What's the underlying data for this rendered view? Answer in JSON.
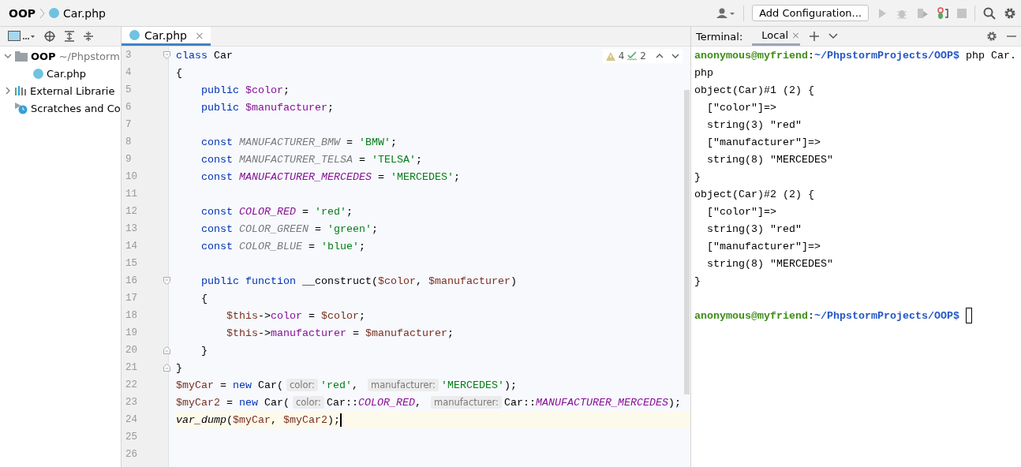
{
  "breadcrumbs": [
    "OOP",
    "Car.php"
  ],
  "run_toolbar": {
    "config_button": "Add Configuration..."
  },
  "project_tree": [
    {
      "name": "OOP",
      "path": "~/Phpstorm",
      "kind": "folder",
      "expanded": true,
      "children": [
        {
          "name": "Car.php",
          "kind": "php"
        }
      ]
    },
    {
      "name": "External Librarie",
      "kind": "library",
      "expanded": false
    },
    {
      "name": "Scratches and Co",
      "kind": "scratch"
    }
  ],
  "editor": {
    "tabs": [
      {
        "label": "Car.php",
        "close": "×",
        "selected": true
      }
    ],
    "inspections": {
      "warnings": "4",
      "typos": "2"
    },
    "lines": [
      {
        "no": "3",
        "kind": "fold_start",
        "current": false,
        "tokens": [
          {
            "kind": "kw",
            "text": "class"
          },
          {
            "kind": "plain",
            "text": " Car"
          }
        ]
      },
      {
        "no": "4",
        "kind": "code",
        "current": false,
        "tokens": [
          {
            "kind": "plain",
            "text": "{"
          }
        ]
      },
      {
        "no": "5",
        "kind": "code",
        "current": false,
        "tokens": [
          {
            "kind": "kw",
            "text": "    public "
          },
          {
            "kind": "prop",
            "text": "$color"
          },
          {
            "kind": "plain",
            "text": ";"
          }
        ]
      },
      {
        "no": "6",
        "kind": "code",
        "current": false,
        "tokens": [
          {
            "kind": "kw",
            "text": "    public "
          },
          {
            "kind": "prop",
            "text": "$manufacturer"
          },
          {
            "kind": "plain",
            "text": ";"
          }
        ]
      },
      {
        "no": "7",
        "kind": "code",
        "current": false
      },
      {
        "no": "8",
        "kind": "code",
        "current": false,
        "tokens": [
          {
            "kind": "kw",
            "text": "    const "
          },
          {
            "kind": "const",
            "text": "MANUFACTURER_BMW"
          },
          {
            "kind": "plain",
            "text": " = "
          },
          {
            "kind": "str",
            "text": "'BMW'"
          },
          {
            "kind": "plain",
            "text": ";"
          }
        ]
      },
      {
        "no": "9",
        "kind": "code",
        "current": false,
        "tokens": [
          {
            "kind": "kw",
            "text": "    const "
          },
          {
            "kind": "const",
            "text": "MANUFACTURER_TELSA"
          },
          {
            "kind": "plain",
            "text": " = "
          },
          {
            "kind": "str",
            "text": "'TELSA'"
          },
          {
            "kind": "plain",
            "text": ";"
          }
        ]
      },
      {
        "no": "10",
        "kind": "code",
        "current": false,
        "tokens": [
          {
            "kind": "kw",
            "text": "    const "
          },
          {
            "kind": "constused",
            "text": "MANUFACTURER_MERCEDES"
          },
          {
            "kind": "plain",
            "text": " = "
          },
          {
            "kind": "str",
            "text": "'MERCEDES'"
          },
          {
            "kind": "plain",
            "text": ";"
          }
        ]
      },
      {
        "no": "11",
        "kind": "code",
        "current": false
      },
      {
        "no": "12",
        "kind": "code",
        "current": false,
        "tokens": [
          {
            "kind": "kw",
            "text": "    const "
          },
          {
            "kind": "constused",
            "text": "COLOR_RED"
          },
          {
            "kind": "plain",
            "text": " = "
          },
          {
            "kind": "str",
            "text": "'red'"
          },
          {
            "kind": "plain",
            "text": ";"
          }
        ]
      },
      {
        "no": "13",
        "kind": "code",
        "current": false,
        "tokens": [
          {
            "kind": "kw",
            "text": "    const "
          },
          {
            "kind": "const",
            "text": "COLOR_GREEN"
          },
          {
            "kind": "plain",
            "text": " = "
          },
          {
            "kind": "str",
            "text": "'green'"
          },
          {
            "kind": "plain",
            "text": ";"
          }
        ]
      },
      {
        "no": "14",
        "kind": "code",
        "current": false,
        "tokens": [
          {
            "kind": "kw",
            "text": "    const "
          },
          {
            "kind": "const",
            "text": "COLOR_BLUE"
          },
          {
            "kind": "plain",
            "text": " = "
          },
          {
            "kind": "str",
            "text": "'blue'"
          },
          {
            "kind": "plain",
            "text": ";"
          }
        ]
      },
      {
        "no": "15",
        "kind": "code",
        "current": false
      },
      {
        "no": "16",
        "kind": "fold_start",
        "current": false,
        "tokens": [
          {
            "kind": "kw",
            "text": "    public function"
          },
          {
            "kind": "plain",
            "text": " __construct("
          },
          {
            "kind": "local",
            "text": "$color"
          },
          {
            "kind": "plain",
            "text": ", "
          },
          {
            "kind": "local",
            "text": "$manufacturer"
          },
          {
            "kind": "plain",
            "text": ")"
          }
        ]
      },
      {
        "no": "17",
        "kind": "code",
        "current": false,
        "tokens": [
          {
            "kind": "plain",
            "text": "    {"
          }
        ]
      },
      {
        "no": "18",
        "kind": "code",
        "current": false,
        "tokens": [
          {
            "kind": "local",
            "text": "        $this"
          },
          {
            "kind": "plain",
            "text": "->"
          },
          {
            "kind": "prop",
            "text": "color"
          },
          {
            "kind": "plain",
            "text": " = "
          },
          {
            "kind": "local",
            "text": "$color"
          },
          {
            "kind": "plain",
            "text": ";"
          }
        ]
      },
      {
        "no": "19",
        "kind": "code",
        "current": false,
        "tokens": [
          {
            "kind": "local",
            "text": "        $this"
          },
          {
            "kind": "plain",
            "text": "->"
          },
          {
            "kind": "prop",
            "text": "manufacturer"
          },
          {
            "kind": "plain",
            "text": " = "
          },
          {
            "kind": "local",
            "text": "$manufacturer"
          },
          {
            "kind": "plain",
            "text": ";"
          }
        ]
      },
      {
        "no": "20",
        "kind": "fold_end",
        "current": false,
        "tokens": [
          {
            "kind": "plain",
            "text": "    }"
          }
        ]
      },
      {
        "no": "21",
        "kind": "fold_end",
        "current": false,
        "tokens": [
          {
            "kind": "plain",
            "text": "}"
          }
        ]
      },
      {
        "no": "22",
        "kind": "code",
        "current": false,
        "tokens": [
          {
            "kind": "local",
            "text": "$myCar"
          },
          {
            "kind": "plain",
            "text": " = "
          },
          {
            "kind": "kw",
            "text": "new"
          },
          {
            "kind": "plain",
            "text": " Car("
          },
          {
            "kind": "hint",
            "text": "color:"
          },
          {
            "kind": "str",
            "text": "'red'"
          },
          {
            "kind": "plain",
            "text": ", "
          },
          {
            "kind": "hint",
            "text": "manufacturer:"
          },
          {
            "kind": "str",
            "text": "'MERCEDES'"
          },
          {
            "kind": "plain",
            "text": ");"
          }
        ]
      },
      {
        "no": "23",
        "kind": "code",
        "current": false,
        "tokens": [
          {
            "kind": "local",
            "text": "$myCar2"
          },
          {
            "kind": "plain",
            "text": " = "
          },
          {
            "kind": "kw",
            "text": "new"
          },
          {
            "kind": "plain",
            "text": " Car("
          },
          {
            "kind": "hint",
            "text": "color:"
          },
          {
            "kind": "plain",
            "text": "Car::"
          },
          {
            "kind": "constused",
            "text": "COLOR_RED"
          },
          {
            "kind": "plain",
            "text": ", "
          },
          {
            "kind": "hint",
            "text": "manufacturer:"
          },
          {
            "kind": "plain",
            "text": "Car::"
          },
          {
            "kind": "constused",
            "text": "MANUFACTURER_MERCEDES"
          },
          {
            "kind": "plain",
            "text": ");"
          }
        ]
      },
      {
        "no": "24",
        "kind": "code",
        "current": true,
        "tokens": [
          {
            "kind": "fn",
            "text": "var_dump"
          },
          {
            "kind": "plain",
            "text": "("
          },
          {
            "kind": "local",
            "text": "$myCar"
          },
          {
            "kind": "plain",
            "text": ", "
          },
          {
            "kind": "local",
            "text": "$myCar2"
          },
          {
            "kind": "plain",
            "text": ");"
          }
        ]
      },
      {
        "no": "25",
        "kind": "code",
        "current": false
      },
      {
        "no": "26",
        "kind": "code",
        "current": false
      }
    ]
  },
  "terminal": {
    "title": "Terminal:",
    "tabs": [
      {
        "label": "Local",
        "close": "×",
        "selected": true
      }
    ],
    "lines": [
      {
        "segments": [
          {
            "kind": "user",
            "text": "anonymous@myfriend"
          },
          {
            "kind": "plain",
            "text": ":"
          },
          {
            "kind": "path",
            "text": "~/PhpstormProjects/OOP$"
          },
          {
            "kind": "plain",
            "text": " php Car."
          }
        ]
      },
      {
        "segments": [
          {
            "kind": "plain",
            "text": "php"
          }
        ]
      },
      {
        "segments": [
          {
            "kind": "plain",
            "text": "object(Car)#1 (2) {"
          }
        ]
      },
      {
        "segments": [
          {
            "kind": "plain",
            "text": "  [\"color\"]=>"
          }
        ]
      },
      {
        "segments": [
          {
            "kind": "plain",
            "text": "  string(3) \"red\""
          }
        ]
      },
      {
        "segments": [
          {
            "kind": "plain",
            "text": "  [\"manufacturer\"]=>"
          }
        ]
      },
      {
        "segments": [
          {
            "kind": "plain",
            "text": "  string(8) \"MERCEDES\""
          }
        ]
      },
      {
        "segments": [
          {
            "kind": "plain",
            "text": "}"
          }
        ]
      },
      {
        "segments": [
          {
            "kind": "plain",
            "text": "object(Car)#2 (2) {"
          }
        ]
      },
      {
        "segments": [
          {
            "kind": "plain",
            "text": "  [\"color\"]=>"
          }
        ]
      },
      {
        "segments": [
          {
            "kind": "plain",
            "text": "  string(3) \"red\""
          }
        ]
      },
      {
        "segments": [
          {
            "kind": "plain",
            "text": "  [\"manufacturer\"]=>"
          }
        ]
      },
      {
        "segments": [
          {
            "kind": "plain",
            "text": "  string(8) \"MERCEDES\""
          }
        ]
      },
      {
        "segments": [
          {
            "kind": "plain",
            "text": "}"
          }
        ]
      }
    ],
    "prompt": {
      "cursor": true,
      "segments": [
        {
          "kind": "user",
          "text": "anonymous@myfriend"
        },
        {
          "kind": "plain",
          "text": ":"
        },
        {
          "kind": "path",
          "text": "~/PhpstormProjects/OOP$"
        }
      ]
    }
  }
}
